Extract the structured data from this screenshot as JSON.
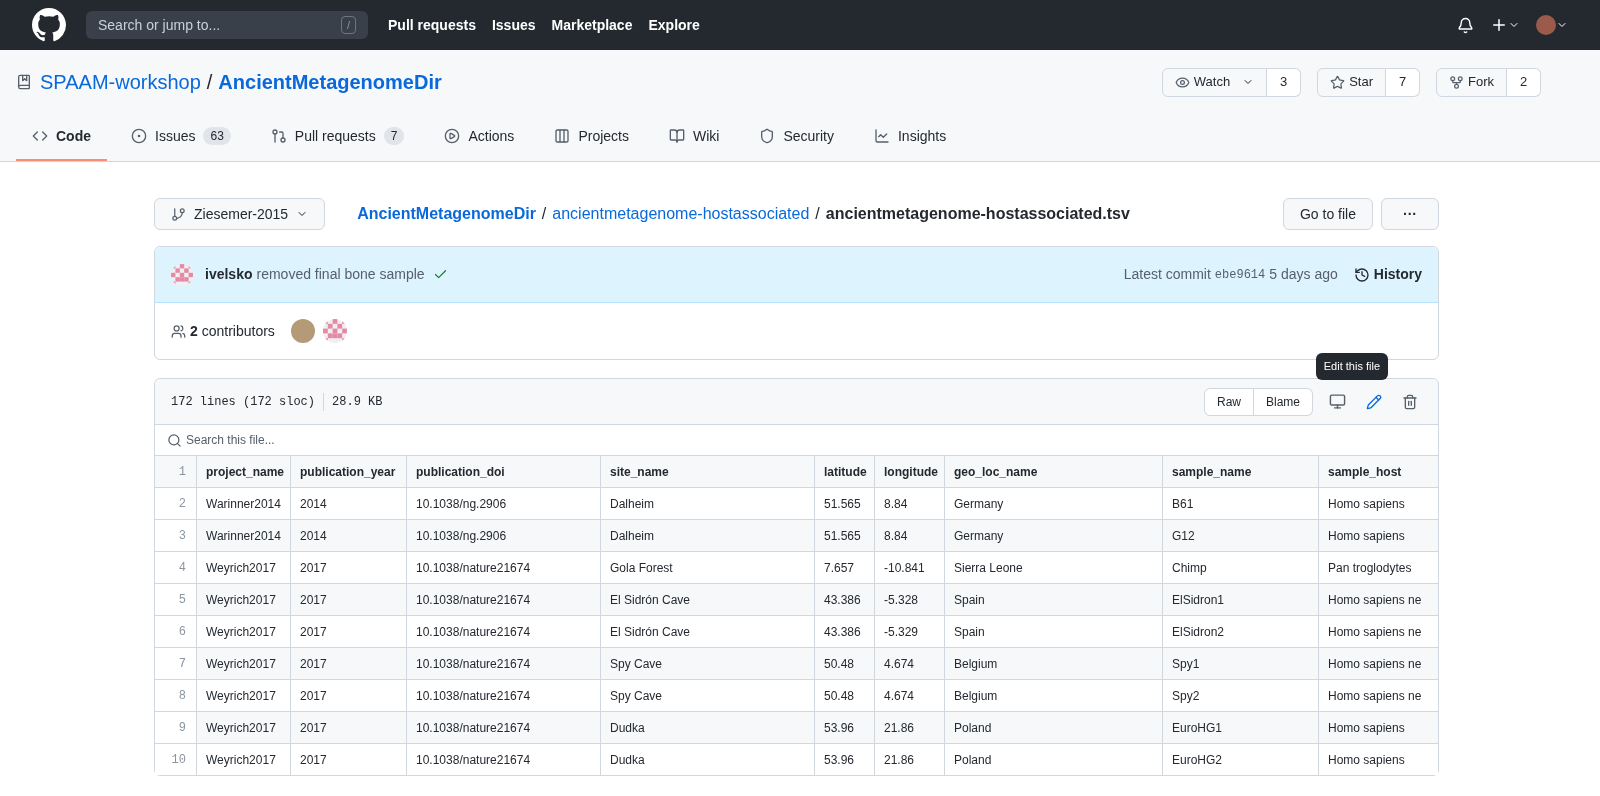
{
  "topbar": {
    "search_placeholder": "Search or jump to...",
    "shortcut": "/",
    "links": [
      "Pull requests",
      "Issues",
      "Marketplace",
      "Explore"
    ]
  },
  "repo": {
    "owner": "SPAAM-workshop",
    "separator": "/",
    "name": "AncientMetagenomeDir",
    "actions": [
      {
        "kind": "watch",
        "label": "Watch",
        "count": "3"
      },
      {
        "kind": "star",
        "label": "Star",
        "count": "7"
      },
      {
        "kind": "fork",
        "label": "Fork",
        "count": "2"
      }
    ]
  },
  "tabs": [
    {
      "kind": "code",
      "label": "Code",
      "selected": true
    },
    {
      "kind": "issues",
      "label": "Issues",
      "count": "63",
      "selected": false
    },
    {
      "kind": "pulls",
      "label": "Pull requests",
      "count": "7",
      "selected": false
    },
    {
      "kind": "actions",
      "label": "Actions",
      "selected": false
    },
    {
      "kind": "projects",
      "label": "Projects",
      "selected": false
    },
    {
      "kind": "wiki",
      "label": "Wiki",
      "selected": false
    },
    {
      "kind": "security",
      "label": "Security",
      "selected": false
    },
    {
      "kind": "insights",
      "label": "Insights",
      "selected": false
    }
  ],
  "branch": "Ziesemer-2015",
  "breadcrumb": {
    "root": "AncientMetagenomeDir",
    "folder": "ancientmetagenome-hostassociated",
    "file": "ancientmetagenome-hostassociated.tsv",
    "separator": "/"
  },
  "go_to_file": "Go to file",
  "more": "···",
  "commit": {
    "author": "ivelsko",
    "message": "removed final bone sample",
    "label": "Latest commit",
    "sha": "ebe9614",
    "time": "5 days ago",
    "history": "History"
  },
  "contributors": {
    "count": "2",
    "label": "contributors"
  },
  "file": {
    "lines": "172 lines (172 sloc)",
    "size": "28.9 KB",
    "buttons": [
      "Raw",
      "Blame"
    ],
    "tooltip": "Edit this file",
    "search_placeholder": "Search this file..."
  },
  "table": {
    "columns": [
      "project_name",
      "publication_year",
      "publication_doi",
      "site_name",
      "latitude",
      "longitude",
      "geo_loc_name",
      "sample_name",
      "sample_host"
    ],
    "rows": [
      {
        "line": "2",
        "cells": [
          "Warinner2014",
          "2014",
          "10.1038/ng.2906",
          "Dalheim",
          "51.565",
          "8.84",
          "Germany",
          "B61",
          "Homo sapiens"
        ]
      },
      {
        "line": "3",
        "cells": [
          "Warinner2014",
          "2014",
          "10.1038/ng.2906",
          "Dalheim",
          "51.565",
          "8.84",
          "Germany",
          "G12",
          "Homo sapiens"
        ]
      },
      {
        "line": "4",
        "cells": [
          "Weyrich2017",
          "2017",
          "10.1038/nature21674",
          "Gola Forest",
          "7.657",
          "-10.841",
          "Sierra Leone",
          "Chimp",
          "Pan troglodytes"
        ]
      },
      {
        "line": "5",
        "cells": [
          "Weyrich2017",
          "2017",
          "10.1038/nature21674",
          "El Sidrón Cave",
          "43.386",
          "-5.328",
          "Spain",
          "ElSidron1",
          "Homo sapiens ne"
        ]
      },
      {
        "line": "6",
        "cells": [
          "Weyrich2017",
          "2017",
          "10.1038/nature21674",
          "El Sidrón Cave",
          "43.386",
          "-5.329",
          "Spain",
          "ElSidron2",
          "Homo sapiens ne"
        ]
      },
      {
        "line": "7",
        "cells": [
          "Weyrich2017",
          "2017",
          "10.1038/nature21674",
          "Spy Cave",
          "50.48",
          "4.674",
          "Belgium",
          "Spy1",
          "Homo sapiens ne"
        ]
      },
      {
        "line": "8",
        "cells": [
          "Weyrich2017",
          "2017",
          "10.1038/nature21674",
          "Spy Cave",
          "50.48",
          "4.674",
          "Belgium",
          "Spy2",
          "Homo sapiens ne"
        ]
      },
      {
        "line": "9",
        "cells": [
          "Weyrich2017",
          "2017",
          "10.1038/nature21674",
          "Dudka",
          "53.96",
          "21.86",
          "Poland",
          "EuroHG1",
          "Homo sapiens"
        ]
      },
      {
        "line": "10",
        "cells": [
          "Weyrich2017",
          "2017",
          "10.1038/nature21674",
          "Dudka",
          "53.96",
          "21.86",
          "Poland",
          "EuroHG2",
          "Homo sapiens"
        ]
      }
    ],
    "header_line": "1"
  }
}
